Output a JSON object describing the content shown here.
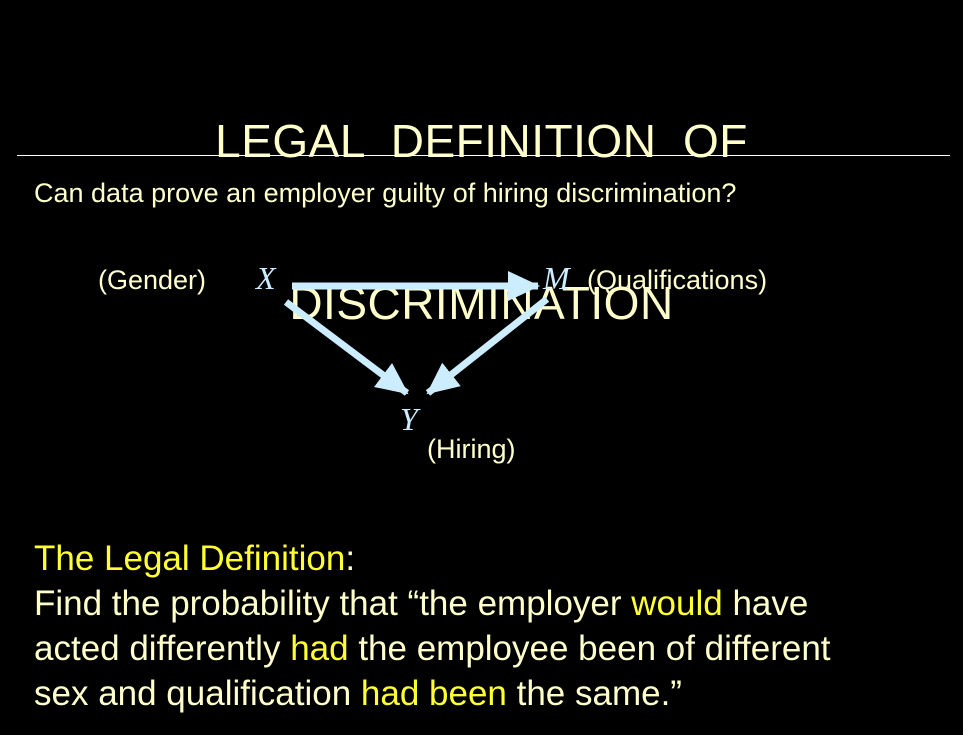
{
  "title": {
    "line1": "LEGAL  DEFINITION  OF",
    "line2": "DISCRIMINATION"
  },
  "question": "Can data prove an employer guilty of hiring discrimination?",
  "diagram": {
    "nodes": {
      "x": {
        "var": "X",
        "label": "(Gender)"
      },
      "m": {
        "var": "M",
        "label": "(Qualifications)"
      },
      "y": {
        "var": "Y",
        "label": "(Hiring)"
      }
    },
    "edges": [
      {
        "from": "X",
        "to": "M"
      },
      {
        "from": "X",
        "to": "Y"
      },
      {
        "from": "M",
        "to": "Y"
      }
    ],
    "colors": {
      "arrow": "#ccecff",
      "variable": "#ccecff",
      "label": "#ffffcc"
    }
  },
  "definition": {
    "heading": "The Legal Definition",
    "heading_colon": ":",
    "line1_a": "Find the probability that “the employer ",
    "line1_b": "would",
    "line1_c": " have",
    "line2_a": "acted differently ",
    "line2_b": "had",
    "line2_c": " the employee been of different",
    "line3_a": "sex and qualification ",
    "line3_b": "had been",
    "line3_c": " the same.”"
  },
  "colors": {
    "background": "#000000",
    "text": "#ffffcc",
    "highlight": "#ffff33",
    "rule": "#ffffff"
  }
}
